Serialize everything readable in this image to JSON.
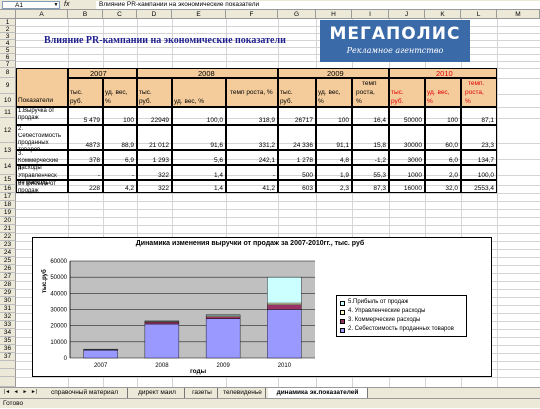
{
  "formula_bar": {
    "name_box": "A1",
    "fx": "fx",
    "content": "Влияние PR-кампании на экономические показатели"
  },
  "columns": [
    "A",
    "B",
    "C",
    "D",
    "E",
    "F",
    "G",
    "H",
    "I",
    "J",
    "K",
    "L",
    "M"
  ],
  "rows": [
    "1",
    "2",
    "3",
    "4",
    "5",
    "6",
    "7",
    "8",
    "9",
    "10",
    "11",
    "12",
    "13",
    "14",
    "15",
    "16",
    "17",
    "18",
    "19",
    "20",
    "21",
    "22",
    "23",
    "24",
    "25",
    "26",
    "27",
    "28",
    "29",
    "30",
    "31",
    "32",
    "33",
    "34",
    "35",
    "36",
    "37"
  ],
  "sheet_title": "Влияние PR-кампании на экономические показатели",
  "logo": {
    "title": "МЕГАПОЛИС",
    "subtitle": "Рекламное агентство"
  },
  "table": {
    "years": [
      "2007",
      "2008",
      "2009",
      "2010"
    ],
    "header_indicators": "Показатели",
    "subheaders": {
      "tys": "тыс.",
      "rub": "руб.",
      "rub2": "тыс. руб.",
      "ud_ves": "уд. вес,",
      "pct": "%",
      "ud_ves_pct": "уд. вес, %",
      "temp_rosta_pct": "темп роста, %",
      "temp": "темп",
      "rosta": "роста,",
      "temp_dot": "темп.",
      "rosta2": "роста,"
    },
    "rows": [
      {
        "label1": "1.Выручка от",
        "label2": "продаж",
        "label3": "",
        "values": [
          "5 479",
          "100",
          "22949",
          "100,0",
          "318,9",
          "26717",
          "100",
          "16,4",
          "50000",
          "100",
          "87,1"
        ]
      },
      {
        "label1": "2.",
        "label2": "Себестоимость",
        "label3": "проданных",
        "label4": "товаров",
        "values": [
          "4873",
          "88,9",
          "21 012",
          "91,6",
          "331,2",
          "24 336",
          "91,1",
          "15,8",
          "30000",
          "60,0",
          "23,3"
        ]
      },
      {
        "label1": "3.",
        "label2": "Коммерческие",
        "label3": "расходы",
        "values": [
          "378",
          "6,9",
          "1 293",
          "5,6",
          "242,1",
          "1 278",
          "4,8",
          "-1,2",
          "3000",
          "6,0",
          "134,7"
        ]
      },
      {
        "label1": "4.",
        "label2": "Управленческ",
        "label3": "ие расходы",
        "values": [
          "-",
          "-",
          "322",
          "1,4",
          "-",
          "500",
          "1,9",
          "55,3",
          "1000",
          "2,0",
          "100,0"
        ]
      },
      {
        "label1": "5.Прибыль от",
        "label2": "продаж",
        "label3": "",
        "values": [
          "228",
          "4,2",
          "322",
          "1,4",
          "41,2",
          "603",
          "2,3",
          "87,3",
          "16000",
          "32,0",
          "2553,4"
        ]
      }
    ]
  },
  "chart_data": {
    "type": "bar",
    "title": "Динамика изменения выручки от продаж за 2007-2010гг., тыс. руб",
    "xlabel": "годы",
    "ylabel": "тыс.руб",
    "categories": [
      "2007",
      "2008",
      "2009",
      "2010"
    ],
    "ylim": [
      0,
      60000
    ],
    "yticks": [
      "0",
      "10000",
      "20000",
      "30000",
      "40000",
      "50000",
      "60000"
    ],
    "stacked": true,
    "series": [
      {
        "name": "2. Себестоимость проданных товаров",
        "values": [
          4873,
          21012,
          24336,
          30000
        ],
        "color": "#9999ff"
      },
      {
        "name": "3. Коммерческие расходы",
        "values": [
          378,
          1293,
          1278,
          3000
        ],
        "color": "#993366"
      },
      {
        "name": "4. Управленческие расходы",
        "values": [
          0,
          322,
          500,
          1000
        ],
        "color": "#ffffcc"
      },
      {
        "name": "5.Прибыль от продаж",
        "values": [
          228,
          322,
          603,
          16000
        ],
        "color": "#ccffff"
      }
    ],
    "legend_order": [
      "5.Прибыль от продаж",
      "4. Управленческие расходы",
      "3. Коммерческие расходы",
      "2. Себестоимость проданных товаров"
    ],
    "legend_position": "right"
  },
  "tabs": [
    "справочный материал",
    "директ маил",
    "газеты",
    "телевиденье",
    "динамика эк.показателей"
  ],
  "active_tab": "динамика эк.показателей",
  "nav": [
    "|◄",
    "◄",
    "►",
    "►|"
  ],
  "status": "Готово"
}
